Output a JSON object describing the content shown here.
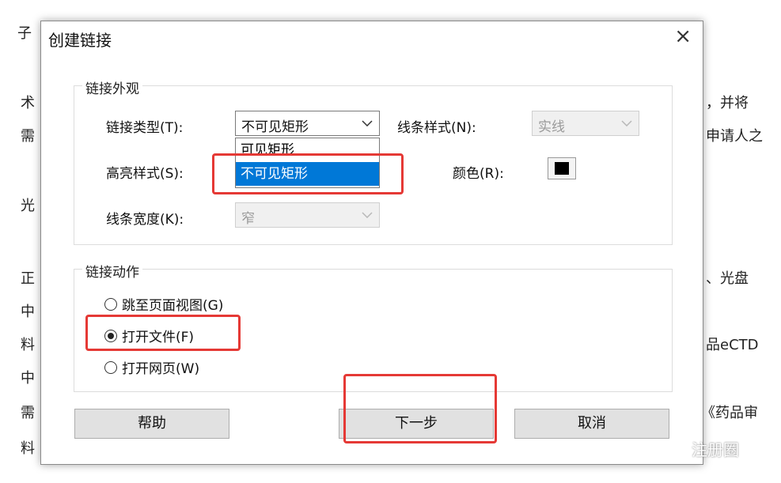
{
  "background": {
    "fragments": [
      "子",
      "术",
      "需",
      "光",
      "正",
      "中",
      "料",
      "中",
      "需",
      "料",
      "，并将",
      "申请人之",
      "、光盘",
      "品eCTD",
      "《药品审"
    ]
  },
  "dialog": {
    "title": "创建链接",
    "close_symbol": "×",
    "appearance": {
      "legend": "链接外观",
      "link_type_label": "链接类型(T):",
      "link_type_value": "不可见矩形",
      "link_type_options": [
        "可见矩形",
        "不可见矩形"
      ],
      "line_style_label": "线条样式(N):",
      "line_style_value": "实线",
      "highlight_label": "高亮样式(S):",
      "color_label": "颜色(R):",
      "color_value": "#000000",
      "line_width_label": "线条宽度(K):",
      "line_width_value": "窄"
    },
    "action": {
      "legend": "链接动作",
      "options": [
        "跳至页面视图(G)",
        "打开文件(F)",
        "打开网页(W)"
      ],
      "selected_index": 1
    },
    "buttons": {
      "help": "帮助",
      "next": "下一步",
      "cancel": "取消"
    }
  },
  "watermark": {
    "text": "注册圈",
    "icon": "wechat-icon"
  },
  "annotation_color": "#e53935"
}
